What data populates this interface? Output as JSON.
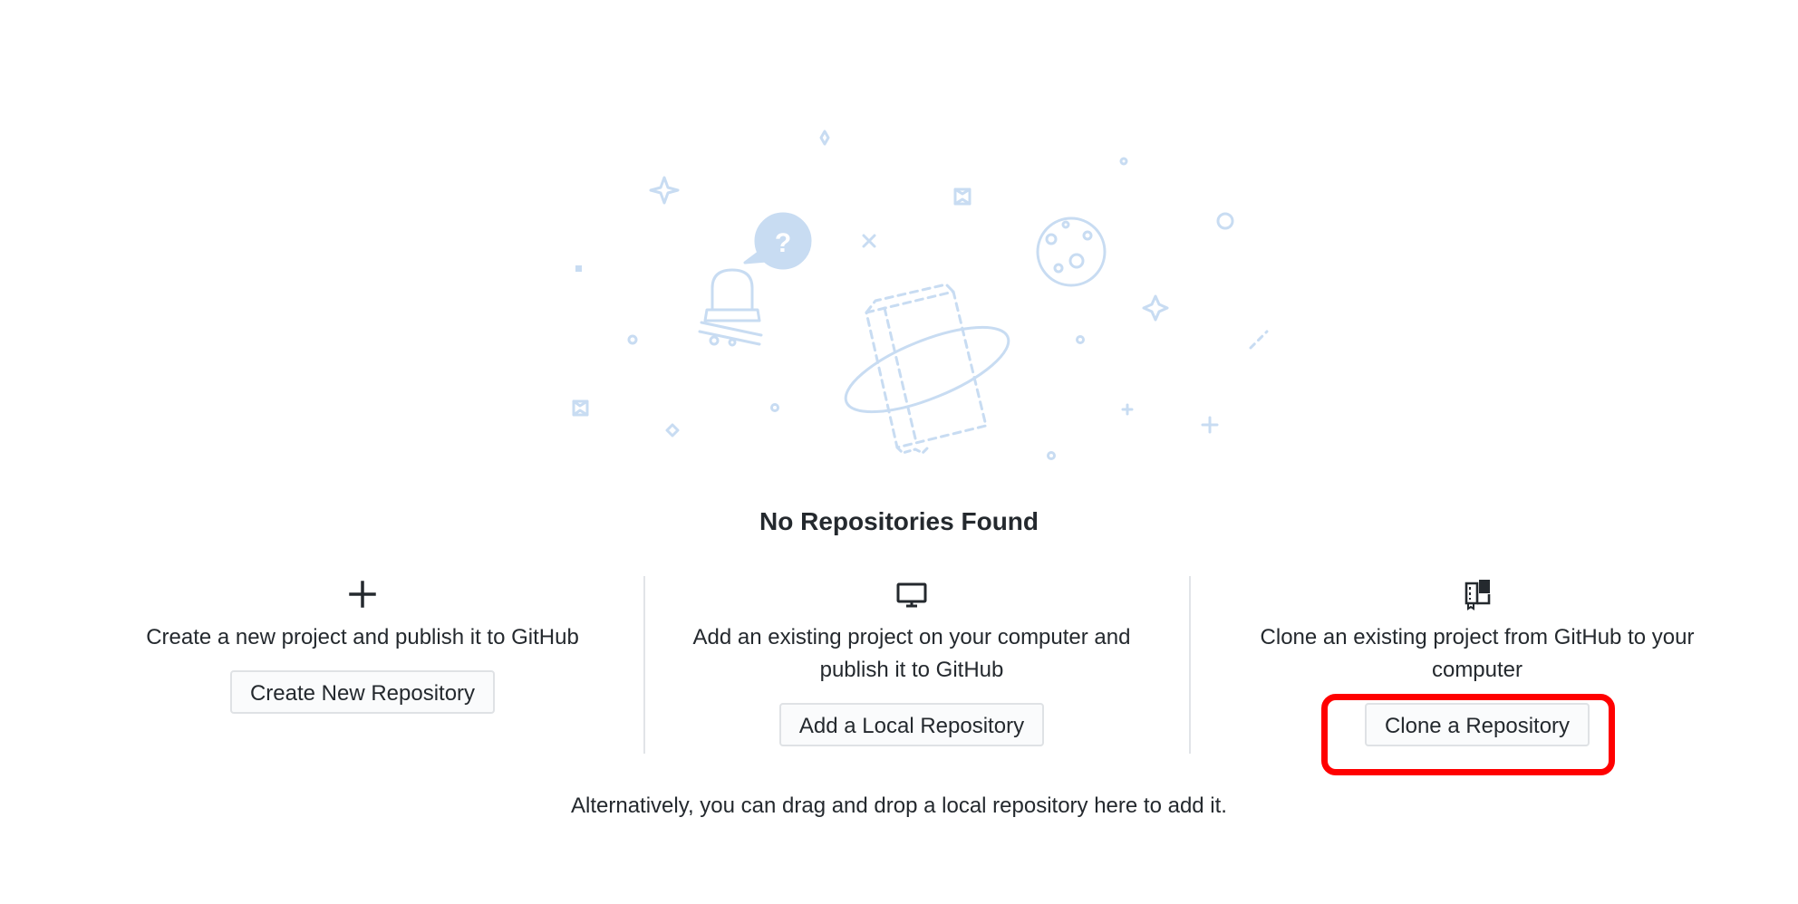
{
  "heading": "No Repositories Found",
  "actions": [
    {
      "icon": "plus-icon",
      "description": "Create a new project and publish it to GitHub",
      "button_label": "Create New Repository"
    },
    {
      "icon": "monitor-icon",
      "description": "Add an existing project on your computer and publish it to GitHub",
      "button_label": "Add a Local Repository"
    },
    {
      "icon": "repo-clone-icon",
      "description": "Clone an existing project from GitHub to your computer",
      "button_label": "Clone a Repository"
    }
  ],
  "footer": "Alternatively, you can drag and drop a local repository here to add it.",
  "colors": {
    "illustration": "#c8dcf2",
    "highlight": "#ff0000",
    "text": "#24292e",
    "button_bg": "#fafbfc",
    "divider": "#e1e4e8"
  }
}
